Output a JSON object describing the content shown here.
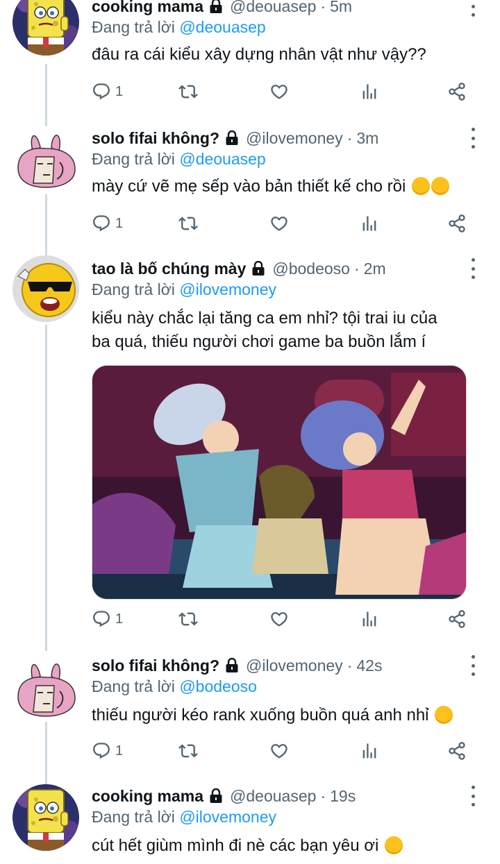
{
  "tweets": [
    {
      "name": "cooking mama",
      "handle": "@deouasep",
      "time": "5m",
      "replying_prefix": "Đang trả lời",
      "replying_to": "@deouasep",
      "text": "đâu ra cái kiểu xây dựng nhân vật như vậy??",
      "reply_count": "1",
      "avatar": "spongebob-avatar"
    },
    {
      "name": "solo fifai không?",
      "handle": "@ilovemoney",
      "time": "3m",
      "replying_prefix": "Đang trả lời",
      "replying_to": "@deouasep",
      "text": "mày cứ vẽ mẹ sếp vào bản thiết kế cho rồi",
      "text_emoji": "hugging-face x2",
      "reply_count": "1",
      "avatar": "pink-bunny-avatar"
    },
    {
      "name": "tao là bố chúng mày",
      "handle": "@bodeoso",
      "time": "2m",
      "replying_prefix": "Đang trả lời",
      "replying_to": "@ilovemoney",
      "text_line1": "kiểu này chắc lại tăng ca em nhỉ? tội trai iu của",
      "text_line2": "ba quá, thiếu người chơi game ba buồn lắm í",
      "media": "cartoon-image-three-laughing-girls",
      "reply_count": "1",
      "avatar": "sunglasses-smiley-avatar"
    },
    {
      "name": "solo fifai không?",
      "handle": "@ilovemoney",
      "time": "42s",
      "replying_prefix": "Đang trả lời",
      "replying_to": "@bodeoso",
      "text": "thiếu người kéo rank xuống buồn quá anh nhỉ",
      "text_emoji": "pensive-face",
      "reply_count": "1",
      "avatar": "pink-bunny-avatar"
    },
    {
      "name": "cooking mama",
      "handle": "@deouasep",
      "time": "19s",
      "replying_prefix": "Đang trả lời",
      "replying_to": "@ilovemoney",
      "text": "cút hết giùm mình đi nè các bạn yêu ơi",
      "text_emoji": "hugging-face",
      "avatar": "spongebob-avatar"
    }
  ],
  "colors": {
    "text": "#0f1419",
    "secondary": "#536471",
    "link": "#1d9bf0",
    "thread_line": "#cfd9de"
  },
  "icons": [
    "reply-icon",
    "retweet-icon",
    "like-icon",
    "analytics-icon",
    "share-icon",
    "lock-icon",
    "more-icon"
  ]
}
